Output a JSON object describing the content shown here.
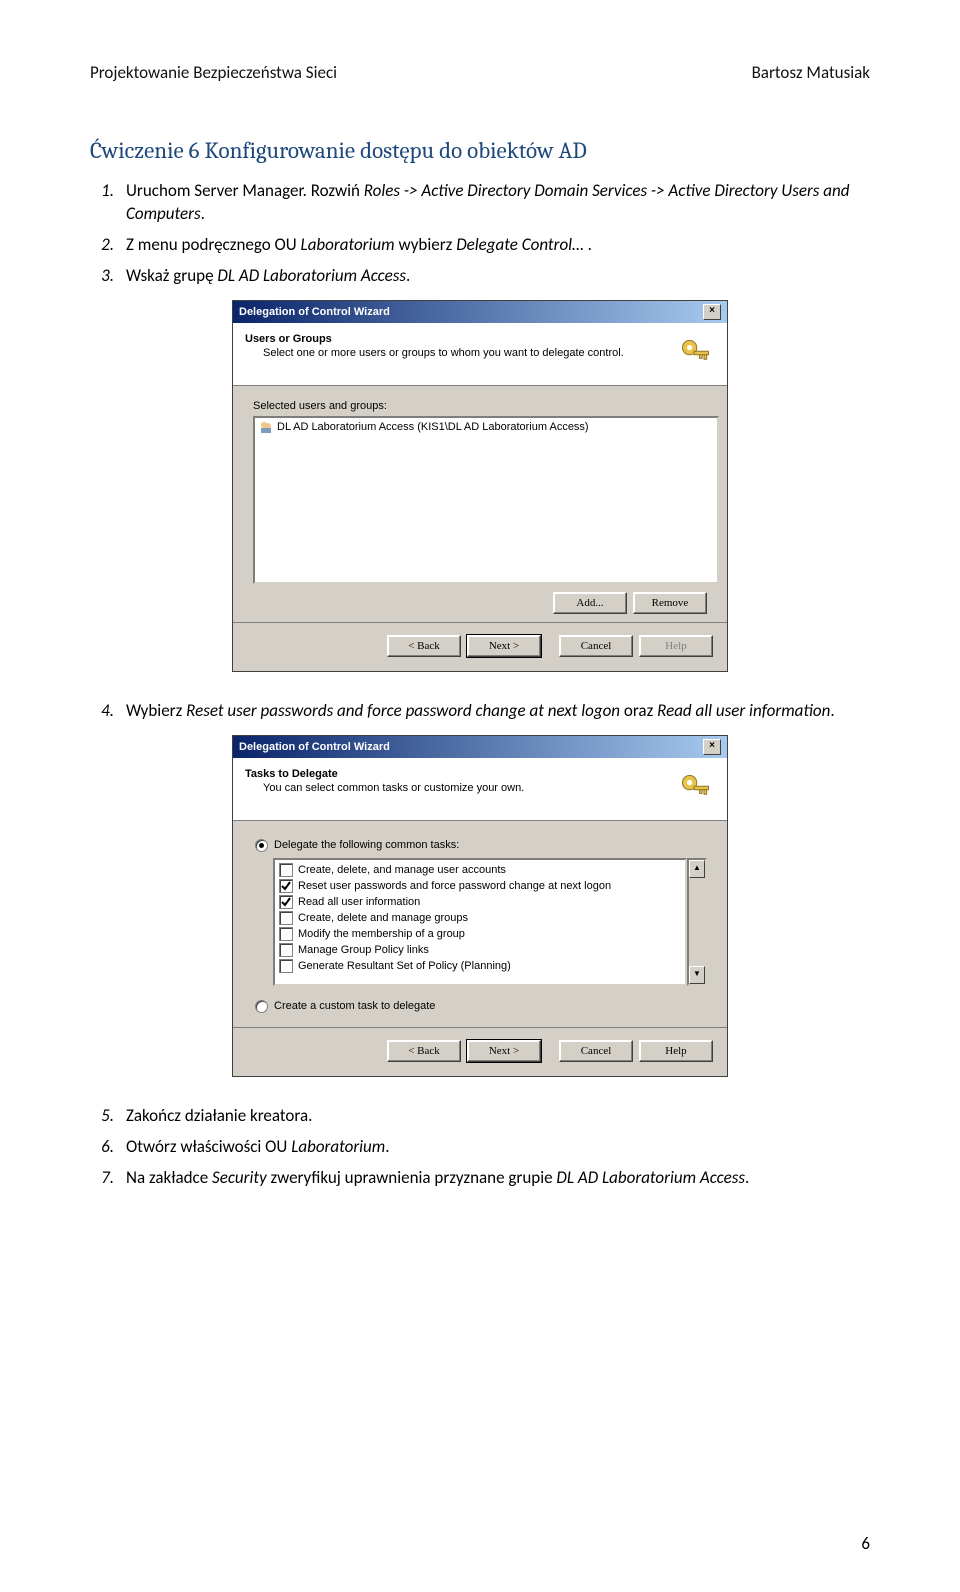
{
  "header": {
    "left": "Projektowanie Bezpieczeństwa Sieci",
    "right": "Bartosz Matusiak"
  },
  "heading": "Ćwiczenie 6 Konfigurowanie dostępu do obiektów AD",
  "steps": {
    "s1": {
      "n": "1.",
      "pre": "Uruchom Server Manager. Rozwiń ",
      "em1": "Roles -> Active Directory Domain Services -> Active Directory Users and Computers",
      "post": "."
    },
    "s2": {
      "n": "2.",
      "pre": "Z menu podręcznego OU ",
      "em1": "Laboratorium",
      "mid": " wybierz ",
      "em2": "Delegate Control…",
      "post": " ."
    },
    "s3": {
      "n": "3.",
      "pre": "Wskaż grupę ",
      "em1": "DL AD Laboratorium Access",
      "post": "."
    },
    "s4": {
      "n": "4.",
      "pre": "Wybierz ",
      "em1": "Reset user passwords and force password change at next logon",
      "mid": " oraz ",
      "em2": "Read all user information",
      "post": "."
    },
    "s5": {
      "n": "5.",
      "pre": "Zakończ działanie kreatora."
    },
    "s6": {
      "n": "6.",
      "pre": "Otwórz właściwości OU ",
      "em1": "Laboratorium",
      "post": "."
    },
    "s7": {
      "n": "7.",
      "pre": "Na zakładce ",
      "em1": "Security",
      "mid": " zweryfikuj uprawnienia przyznane grupie ",
      "em2": "DL AD Laboratorium Access",
      "post": "."
    }
  },
  "wizard1": {
    "title": "Delegation of Control Wizard",
    "head_title": "Users or Groups",
    "head_sub": "Select one or more users or groups to whom you want to delegate control.",
    "list_label": "Selected users and groups:",
    "entry": "DL AD Laboratorium Access (KIS1\\DL AD Laboratorium Access)",
    "add": "Add...",
    "remove": "Remove",
    "back": "< Back",
    "next": "Next >",
    "cancel": "Cancel",
    "help": "Help"
  },
  "wizard2": {
    "title": "Delegation of Control Wizard",
    "head_title": "Tasks to Delegate",
    "head_sub": "You can select common tasks or customize your own.",
    "opt_common": "Delegate the following common tasks:",
    "opt_custom": "Create a custom task to delegate",
    "tasks": [
      {
        "label": "Create, delete, and manage user accounts",
        "checked": false
      },
      {
        "label": "Reset user passwords and force password change at next logon",
        "checked": true
      },
      {
        "label": "Read all user information",
        "checked": true
      },
      {
        "label": "Create, delete and manage groups",
        "checked": false
      },
      {
        "label": "Modify the membership of a group",
        "checked": false
      },
      {
        "label": "Manage Group Policy links",
        "checked": false
      },
      {
        "label": "Generate Resultant Set of Policy (Planning)",
        "checked": false
      }
    ],
    "back": "< Back",
    "next": "Next >",
    "cancel": "Cancel",
    "help": "Help"
  },
  "page_number": "6"
}
